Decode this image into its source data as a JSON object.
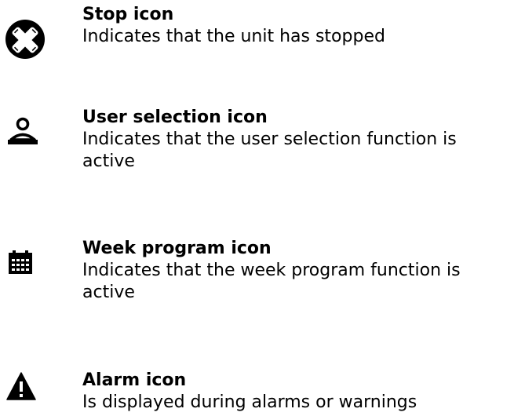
{
  "entries": [
    {
      "icon": "stop-icon",
      "title": "Stop icon",
      "description": "Indicates that the unit has stopped"
    },
    {
      "icon": "user-selection-icon",
      "title": "User selection icon",
      "description": "Indicates that the user selection function is active"
    },
    {
      "icon": "week-program-icon",
      "title": "Week program icon",
      "description": "Indicates that the week program function is active"
    },
    {
      "icon": "alarm-icon",
      "title": "Alarm icon",
      "description": "Is displayed during alarms or warnings"
    }
  ]
}
